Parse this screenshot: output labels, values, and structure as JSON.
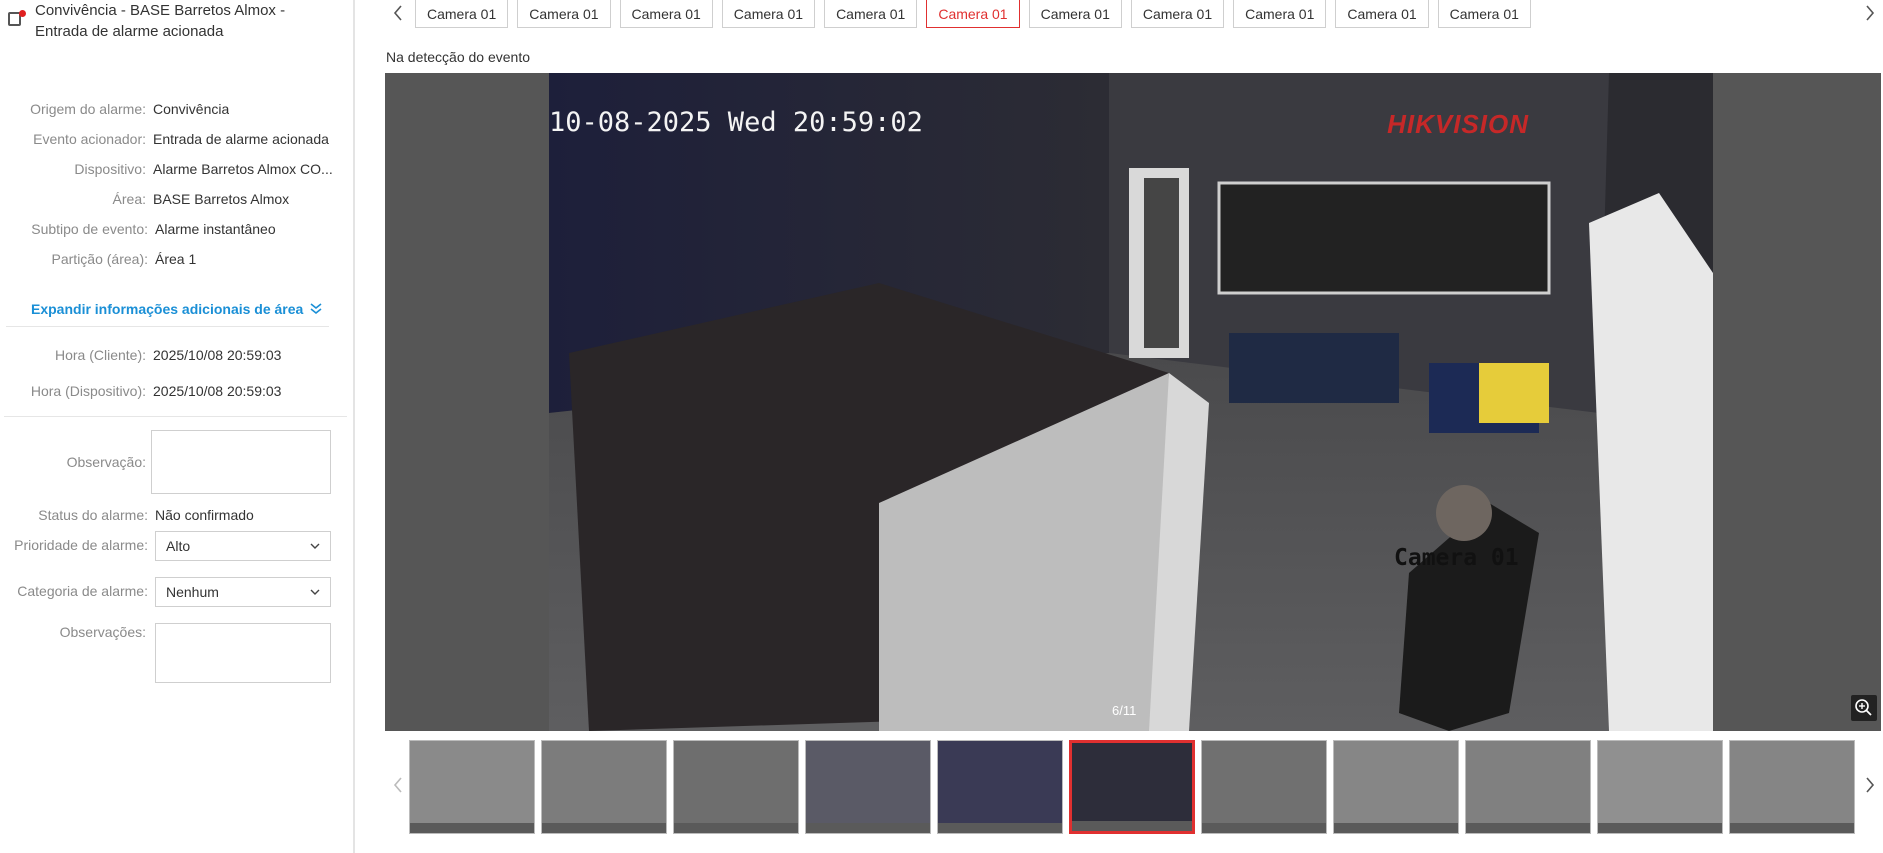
{
  "header": {
    "title": "Convivência - BASE Barretos Almox - Entrada de alarme acionada"
  },
  "details": [
    {
      "label": "Origem do alarme:",
      "value": "Convivência"
    },
    {
      "label": "Evento acionador:",
      "value": "Entrada de alarme acionada"
    },
    {
      "label": "Dispositivo:",
      "value": "Alarme Barretos Almox CO..."
    },
    {
      "label": "Área:",
      "value": "BASE Barretos Almox"
    },
    {
      "label": "Subtipo de evento:",
      "value": "Alarme instantâneo"
    },
    {
      "label": "Partição (área):",
      "value": "Área 1"
    }
  ],
  "expand_label": "Expandir informações adicionais de área",
  "times": [
    {
      "label": "Hora (Cliente):",
      "value": "2025/10/08 20:59:03"
    },
    {
      "label": "Hora (Dispositivo):",
      "value": "2025/10/08 20:59:03"
    }
  ],
  "form": {
    "observacao_label": "Observação:",
    "status_label": "Status do alarme:",
    "status_value": "Não confirmado",
    "priority_label": "Prioridade de alarme:",
    "priority_value": "Alto",
    "category_label": "Categoria de alarme:",
    "category_value": "Nenhum",
    "observacoes_label": "Observações:"
  },
  "tabs": [
    "Camera 01",
    "Camera 01",
    "Camera 01",
    "Camera 01",
    "Camera 01",
    "Camera 01",
    "Camera 01",
    "Camera 01",
    "Camera 01",
    "Camera 01",
    "Camera 01"
  ],
  "active_tab_index": 5,
  "viewer": {
    "section_title": "Na detecção do evento",
    "osd_time": "10-08-2025 Wed 20:59:02",
    "brand": "HIKVISION",
    "camera_label": "Camera 01",
    "counter": "6/11"
  },
  "thumbnail_count": 11,
  "active_thumbnail_index": 5,
  "colors": {
    "accent": "#e03030",
    "link": "#1a8fd6"
  }
}
